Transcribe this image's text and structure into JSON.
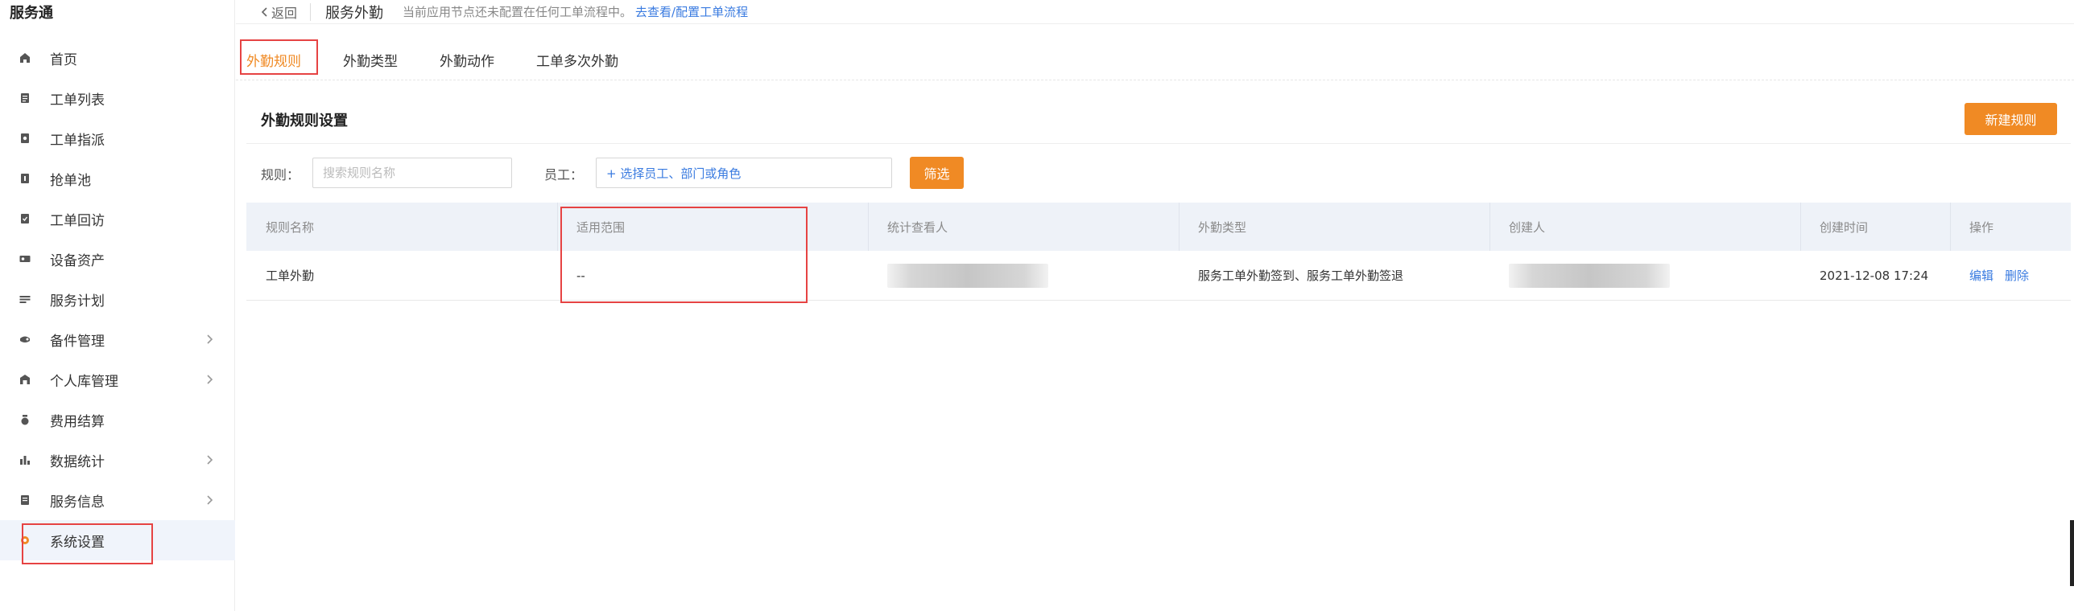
{
  "app": {
    "brand": "服务通"
  },
  "sidebar": {
    "items": [
      {
        "label": "首页",
        "icon": "home-icon",
        "expandable": false
      },
      {
        "label": "工单列表",
        "icon": "clipboard-icon",
        "expandable": false
      },
      {
        "label": "工单指派",
        "icon": "assign-icon",
        "expandable": false
      },
      {
        "label": "抢单池",
        "icon": "pool-icon",
        "expandable": false
      },
      {
        "label": "工单回访",
        "icon": "return-visit-icon",
        "expandable": false
      },
      {
        "label": "设备资产",
        "icon": "device-icon",
        "expandable": false
      },
      {
        "label": "服务计划",
        "icon": "plan-icon",
        "expandable": false
      },
      {
        "label": "备件管理",
        "icon": "parts-icon",
        "expandable": true
      },
      {
        "label": "个人库管理",
        "icon": "warehouse-icon",
        "expandable": true
      },
      {
        "label": "费用结算",
        "icon": "money-bag-icon",
        "expandable": false
      },
      {
        "label": "数据统计",
        "icon": "bar-chart-icon",
        "expandable": true
      },
      {
        "label": "服务信息",
        "icon": "document-icon",
        "expandable": true
      },
      {
        "label": "系统设置",
        "icon": "gear-icon",
        "expandable": false,
        "active": true
      }
    ]
  },
  "header": {
    "back_label": "返回",
    "page_name": "服务外勤",
    "notice": "当前应用节点还未配置在任何工单流程中。",
    "notice_link": "去查看/配置工单流程"
  },
  "tabs": [
    {
      "label": "外勤规则",
      "active": true
    },
    {
      "label": "外勤类型",
      "active": false
    },
    {
      "label": "外勤动作",
      "active": false
    },
    {
      "label": "工单多次外勤",
      "active": false
    }
  ],
  "section": {
    "title": "外勤规则设置",
    "new_button": "新建规则"
  },
  "filter": {
    "rule_label": "规则：",
    "rule_placeholder": "搜索规则名称",
    "staff_label": "员工：",
    "staff_picker": "+ 选择员工、部门或角色",
    "filter_button": "筛选"
  },
  "table": {
    "columns": [
      "规则名称",
      "适用范围",
      "统计查看人",
      "外勤类型",
      "创建人",
      "创建时间",
      "操作"
    ],
    "rows": [
      {
        "name": "工单外勤",
        "scope": "--",
        "viewers": "",
        "types": "服务工单外勤签到、服务工单外勤签退",
        "creator": "",
        "created_at": "2021-12-08 17:24",
        "actions": {
          "edit": "编辑",
          "delete": "删除"
        }
      }
    ]
  },
  "colors": {
    "accent": "#f08a24",
    "link": "#3a7be0",
    "highlight": "#e64343"
  }
}
